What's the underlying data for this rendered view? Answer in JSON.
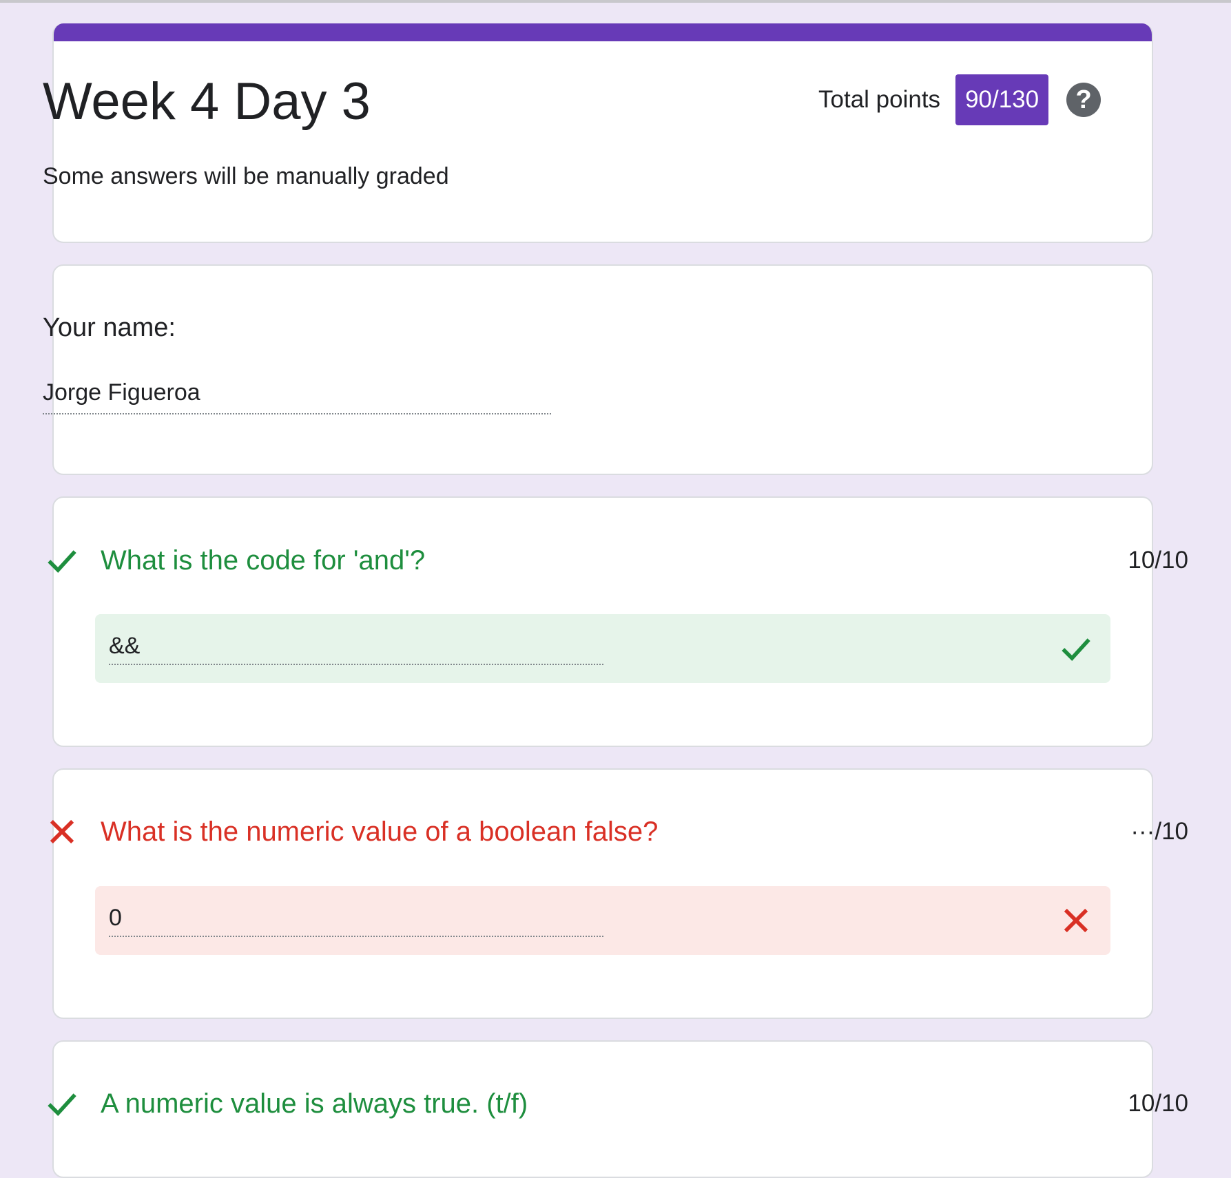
{
  "form": {
    "title": "Week 4 Day 3",
    "description": "Some answers will be manually graded",
    "total_points_label": "Total points",
    "total_points_value": "90/130",
    "help_symbol": "?",
    "accent_color": "#673ab7"
  },
  "name_question": {
    "label": "Your name:",
    "answer": "Jorge Figueroa"
  },
  "questions": [
    {
      "title": "What is the code for 'and'?",
      "score": "10/10",
      "answer": "&&",
      "status": "correct",
      "status_icon": "check-icon",
      "color": "#1e8e3e"
    },
    {
      "title": "What is the numeric value of a boolean false?",
      "score": "···/10",
      "answer": "0",
      "status": "incorrect",
      "status_icon": "cross-icon",
      "color": "#d93025"
    },
    {
      "title": "A numeric value is always true. (t/f)",
      "score": "10/10",
      "status": "correct",
      "status_icon": "check-icon",
      "color": "#1e8e3e"
    }
  ]
}
